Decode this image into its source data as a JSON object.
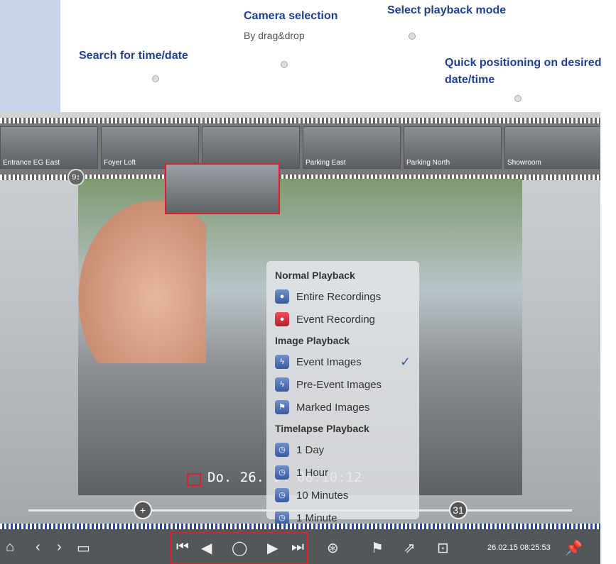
{
  "callouts": {
    "camera_selection": "Camera selection",
    "camera_selection_sub": "By drag&drop",
    "select_playback": "Select playback mode",
    "search_time": "Search for time/date",
    "quick_pos_1": "Quick positioning on desired",
    "quick_pos_2": "date/time"
  },
  "cameras": [
    {
      "label": "Entrance EG East"
    },
    {
      "label": "Foyer Loft"
    },
    {
      "label": ""
    },
    {
      "label": "Parking East"
    },
    {
      "label": "Parking North"
    },
    {
      "label": "Showroom"
    }
  ],
  "timestamp": "Do. 26.  14  08:10:12",
  "menu": {
    "normal_title": "Normal Playback",
    "entire": "Entire Recordings",
    "event_recording": "Event Recording",
    "image_title": "Image Playback",
    "event_images": "Event Images",
    "pre_event": "Pre-Event Images",
    "marked": "Marked Images",
    "timelapse_title": "Timelapse Playback",
    "day": "1 Day",
    "hour": "1 Hour",
    "ten_min": "10 Minutes",
    "minute": "1 Minute",
    "check": "✓"
  },
  "toolbar": {
    "clock": "26.02.15 08:25:53"
  },
  "icons": {
    "slider_plus": "+",
    "slider_calendar": "31",
    "swap": "9↕"
  }
}
